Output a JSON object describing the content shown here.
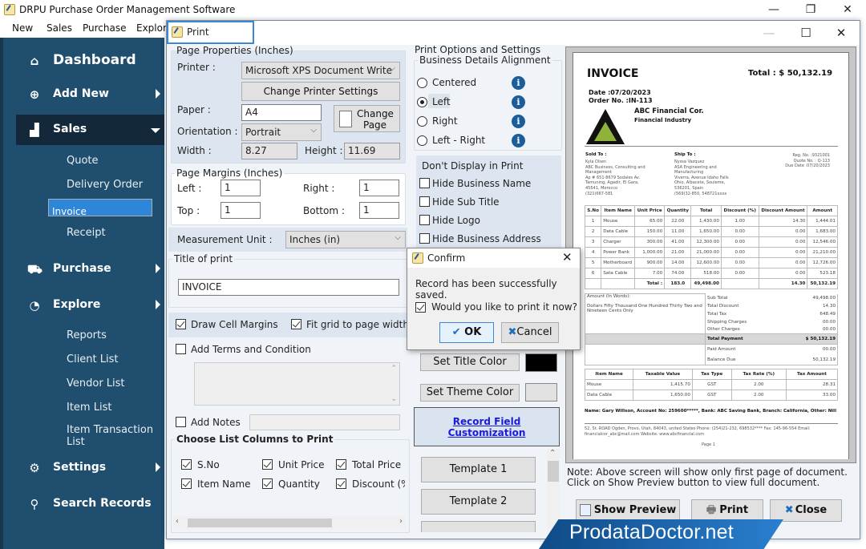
{
  "app": {
    "title": "DRPU Purchase Order Management Software",
    "window_controls": {
      "minimize": "—",
      "maximize": "❐",
      "close": "✕"
    },
    "menu": [
      "New",
      "Sales",
      "Purchase",
      "Explore"
    ]
  },
  "sidebar": {
    "items": [
      {
        "label": "Dashboard",
        "icon": "home-icon"
      },
      {
        "label": "Add New",
        "icon": "add-document-icon"
      },
      {
        "label": "Sales",
        "icon": "chart-icon",
        "expanded": true
      },
      {
        "label": "Purchase",
        "icon": "cart-icon"
      },
      {
        "label": "Explore",
        "icon": "pie-chart-icon"
      },
      {
        "label": "Settings",
        "icon": "gear-icon"
      },
      {
        "label": "Search Records",
        "icon": "search-icon"
      }
    ],
    "sales_sub": [
      "Quote",
      "Delivery Order",
      "Invoice",
      "Receipt"
    ],
    "selected_sub": "Invoice",
    "explore_sub": [
      "Reports",
      "Client List",
      "Vendor List",
      "Item List",
      "Item Transaction List"
    ]
  },
  "print": {
    "title": "Print",
    "page_properties": {
      "legend": "Page Properties (Inches)",
      "printer_label": "Printer :",
      "printer_value": "Microsoft XPS Document Write",
      "change_printer_btn": "Change Printer Settings",
      "paper_label": "Paper :",
      "paper_value": "A4",
      "change_page_btn_1": "Change",
      "change_page_btn_2": "Page",
      "orientation_label": "Orientation :",
      "orientation_value": "Portrait",
      "width_label": "Width :",
      "width_value": "8.27",
      "height_label": "Height :",
      "height_value": "11.69"
    },
    "margins": {
      "legend": "Page Margins (Inches)",
      "left_label": "Left :",
      "left_value": "1",
      "right_label": "Right :",
      "right_value": "1",
      "top_label": "Top  :",
      "top_value": "1",
      "bottom_label": "Bottom  :",
      "bottom_value": "1"
    },
    "measurement_label": "Measurement Unit :",
    "measurement_value": "Inches (in)",
    "title_of_print_legend": "Title of print",
    "title_of_print_value": "INVOICE",
    "draw_cell_margins": {
      "label": "Draw Cell Margins",
      "checked": true
    },
    "fit_grid": {
      "label": "Fit grid to page width",
      "checked": true
    },
    "add_terms": {
      "label": "Add Terms and Condition",
      "checked": false
    },
    "add_notes": {
      "label": "Add Notes",
      "checked": false
    },
    "columns_legend": "Choose List Columns to Print",
    "columns": [
      {
        "label": "S.No",
        "checked": true
      },
      {
        "label": "Unit Price",
        "checked": true
      },
      {
        "label": "Total Price",
        "checked": true
      },
      {
        "label": "Item Name",
        "checked": true
      },
      {
        "label": "Quantity",
        "checked": true
      },
      {
        "label": "Discount (%",
        "checked": true
      }
    ],
    "options": {
      "legend": "Print Options and Settings",
      "alignment_legend": "Business Details Alignment",
      "alignments": [
        "Centered",
        "Left",
        "Right",
        "Left - Right"
      ],
      "selected_alignment": "Left",
      "dont_display_legend": "Don't Display in Print",
      "hide": [
        "Hide Business Name",
        "Hide Sub Title",
        "Hide Logo",
        "Hide Business Address"
      ],
      "set_title_color_btn": "Set Title Color",
      "title_color": "#000000",
      "set_theme_color_btn": "Set Theme Color",
      "theme_color": "#e1e1e1",
      "record_field_link_1": "Record Field",
      "record_field_link_2": "Customization",
      "templates": [
        "Template 1",
        "Template 2"
      ]
    },
    "note_line1": "Note: Above screen will show only first page of document.",
    "note_line2": "Click on Show Preview button to view full document.",
    "show_preview_btn": "Show Preview",
    "print_btn": "Print",
    "close_btn": "Close"
  },
  "invoice": {
    "title": "INVOICE",
    "total_label": "Total : $  50,132.19",
    "date": "Date :07/20/2023",
    "order_no": "Order No. :IN-113",
    "company": "ABC Financial Cor.",
    "industry": "Financial Industry",
    "sold_to_label": "Sold To :",
    "sold_to": [
      "Kyla Olsen",
      "ABC Business, Consulting and",
      "Management",
      "Ap # 651-8679 Sodales Av.",
      "Tamuning, Agadir, El Gara,",
      "45541, Morocco",
      "(321)687-581"
    ],
    "ship_to_label": "Ship To :",
    "ship_to": [
      "Nyssa Vazquez",
      "ASA Engineering and",
      "Manufacturing",
      "Viverra, Avenue Idaho Falls",
      "Ohio, Albacete, Souleme,",
      "536201, Spain",
      "(569)32-850, 548721xxxx"
    ],
    "reg": [
      "Reg. No. :9321001",
      "Quote No. : Q-113",
      "Due Date :07/20/2023"
    ],
    "item_headers": [
      "S.No",
      "Item Name",
      "Unit Price",
      "Quantity",
      "Total",
      "Discount (%)",
      "Discount Amount",
      "Amount"
    ],
    "items": [
      [
        "1",
        "Mouse",
        "65.00",
        "22.00",
        "1,430.00",
        "1.00",
        "14.30",
        "1,444.01"
      ],
      [
        "2",
        "Data Cable",
        "150.00",
        "11.00",
        "1,650.00",
        "0.00",
        "0.00",
        "1,683.00"
      ],
      [
        "3",
        "Charger",
        "300.00",
        "41.00",
        "12,300.00",
        "0.00",
        "0.00",
        "12,546.00"
      ],
      [
        "4",
        "Power Bank",
        "1,000.00",
        "21.00",
        "21,000.00",
        "0.00",
        "0.00",
        "21,210.00"
      ],
      [
        "5",
        "Motherboard",
        "900.00",
        "14.00",
        "12,600.00",
        "0.00",
        "0.00",
        "12,726.00"
      ],
      [
        "6",
        "Sata Cable",
        "7.00",
        "74.00",
        "518.00",
        "0.00",
        "0.00",
        "523.18"
      ]
    ],
    "items_total": [
      "",
      "",
      "Total :",
      "183.0",
      "49,498.00",
      "",
      "14.30",
      "50,132.19"
    ],
    "amount_words_label": "Amount (In Words):",
    "amount_words": "Dollars Fifty Thousand One Hundred Thirty Two and Nineteen Cents Only",
    "summary": [
      [
        "Sub Total",
        "49,498.00"
      ],
      [
        "Total Discount",
        "14.30"
      ],
      [
        "Total Tax",
        "648.49"
      ],
      [
        "Shipping Charges",
        "00.00"
      ],
      [
        "Other Charges",
        "00.00"
      ]
    ],
    "total_payment": [
      "Total Payment",
      "$  50,132.19"
    ],
    "paid": [
      [
        "Paid Amount",
        "00.00"
      ],
      [
        "Balance Due",
        "50,132.19"
      ]
    ],
    "tax_headers": [
      "Item Name",
      "Taxable Value",
      "Tax Type",
      "Tax Rate (%)",
      "Tax Amount"
    ],
    "tax_rows": [
      [
        "Mouse",
        "1,415.70",
        "GST",
        "2.00",
        "28.31"
      ],
      [
        "Data Cable",
        "1,650.00",
        "GST",
        "2.00",
        "33.00"
      ]
    ],
    "bank": "Name: Gary Willson, Account No: 259600*****, Bank: ABC Saving Bank, Branch: California, Other: Nill",
    "address": "52, St. ROAD Ogden, Provo, Utah, 84043, united States  Phone: (254)21-232, 698532****  Fax: 145-96-554  Email: financialcor_abc@mail.com  Website: www.abcfinancial.com",
    "page": "Page 1"
  },
  "confirm": {
    "title": "Confirm",
    "message": "Record has been successfully saved.",
    "print_now": {
      "label": "Would you like to print it now?",
      "checked": true
    },
    "ok_btn": "OK",
    "cancel_btn": "Cancel"
  },
  "watermark": "ProdataDoctor.net"
}
